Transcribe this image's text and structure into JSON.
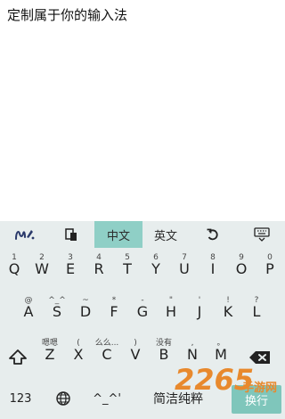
{
  "document": {
    "text": "定制属于你的输入法"
  },
  "toolbar": {
    "chinese_label": "中文",
    "english_label": "英文",
    "active_mode": "中文",
    "accent": "#8fcfc6"
  },
  "rows": [
    {
      "keys": [
        {
          "main": "Q",
          "sub": "1"
        },
        {
          "main": "W",
          "sub": "2"
        },
        {
          "main": "E",
          "sub": "3"
        },
        {
          "main": "R",
          "sub": "4"
        },
        {
          "main": "T",
          "sub": "5"
        },
        {
          "main": "Y",
          "sub": "6"
        },
        {
          "main": "U",
          "sub": "7"
        },
        {
          "main": "I",
          "sub": "8"
        },
        {
          "main": "O",
          "sub": "9"
        },
        {
          "main": "P",
          "sub": "0"
        }
      ]
    },
    {
      "keys": [
        {
          "main": "A",
          "sub": "@"
        },
        {
          "main": "S",
          "sub": "^_^"
        },
        {
          "main": "D",
          "sub": "~"
        },
        {
          "main": "F",
          "sub": "*"
        },
        {
          "main": "G",
          "sub": "-"
        },
        {
          "main": "H",
          "sub": "\""
        },
        {
          "main": "J",
          "sub": "'"
        },
        {
          "main": "K",
          "sub": "!"
        },
        {
          "main": "L",
          "sub": "?"
        }
      ]
    },
    {
      "keys": [
        {
          "main": "Z",
          "sub": "嗯嗯"
        },
        {
          "main": "X",
          "sub": "("
        },
        {
          "main": "C",
          "sub": "么么..."
        },
        {
          "main": "V",
          "sub": ")"
        },
        {
          "main": "B",
          "sub": "没有"
        },
        {
          "main": "N",
          "sub": ","
        },
        {
          "main": "M",
          "sub": "。"
        }
      ]
    }
  ],
  "bottom": {
    "num_label": "123",
    "face_label": "^_^'",
    "space_label": "简洁纯粹",
    "enter_label": "换行"
  },
  "icons": {
    "handwriting": "handwriting-icon",
    "clipboard": "clipboard-icon",
    "undo": "undo-icon",
    "hide_keyboard": "keyboard-hide-icon",
    "shift": "shift-arrow-icon",
    "backspace": "backspace-icon",
    "globe": "globe-icon"
  },
  "watermark": {
    "number": "2265",
    "text": "手游网"
  }
}
